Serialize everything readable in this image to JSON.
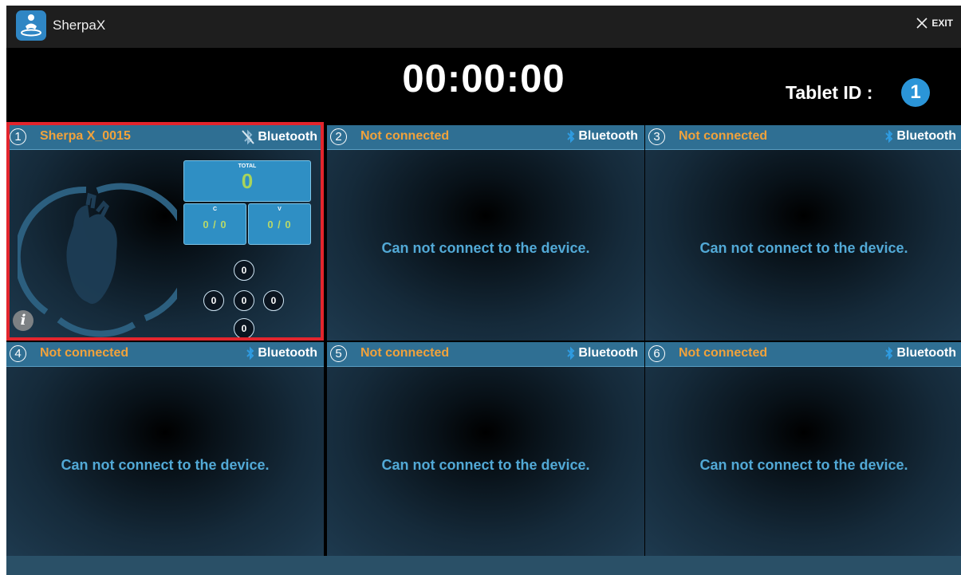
{
  "app": {
    "name": "SherpaX",
    "exit_label": "EXIT"
  },
  "timer": "00:00:00",
  "tablet": {
    "label": "Tablet ID :",
    "id": "1"
  },
  "panels": [
    {
      "number": "1",
      "device_name": "Sherpa X_0015",
      "bluetooth_label": "Bluetooth",
      "connected": true,
      "total_label": "TOTAL",
      "total_value": "0",
      "c_label": "C",
      "c_value": "0 / 0",
      "v_label": "V",
      "v_value": "0 / 0",
      "circles": [
        "0",
        "0",
        "0",
        "0",
        "0"
      ]
    },
    {
      "number": "2",
      "device_name": "Not connected",
      "bluetooth_label": "Bluetooth",
      "message": "Can not connect to the device."
    },
    {
      "number": "3",
      "device_name": "Not connected",
      "bluetooth_label": "Bluetooth",
      "message": "Can not connect to the device."
    },
    {
      "number": "4",
      "device_name": "Not connected",
      "bluetooth_label": "Bluetooth",
      "message": "Can not connect to the device."
    },
    {
      "number": "5",
      "device_name": "Not connected",
      "bluetooth_label": "Bluetooth",
      "message": "Can not connect to the device."
    },
    {
      "number": "6",
      "device_name": "Not connected",
      "bluetooth_label": "Bluetooth",
      "message": "Can not connect to the device."
    }
  ],
  "icons": {
    "app": "cpr-person-icon",
    "exit": "close-icon",
    "bluetooth": "bluetooth-icon",
    "bluetooth_off": "bluetooth-disabled-icon",
    "heart": "heart-icon",
    "info": "info-icon"
  },
  "colors": {
    "header": "#2f6f93",
    "device_name": "#f1a23b",
    "message": "#52a9d6",
    "accent": "#2f8fc4",
    "highlight": "#e3252d"
  }
}
